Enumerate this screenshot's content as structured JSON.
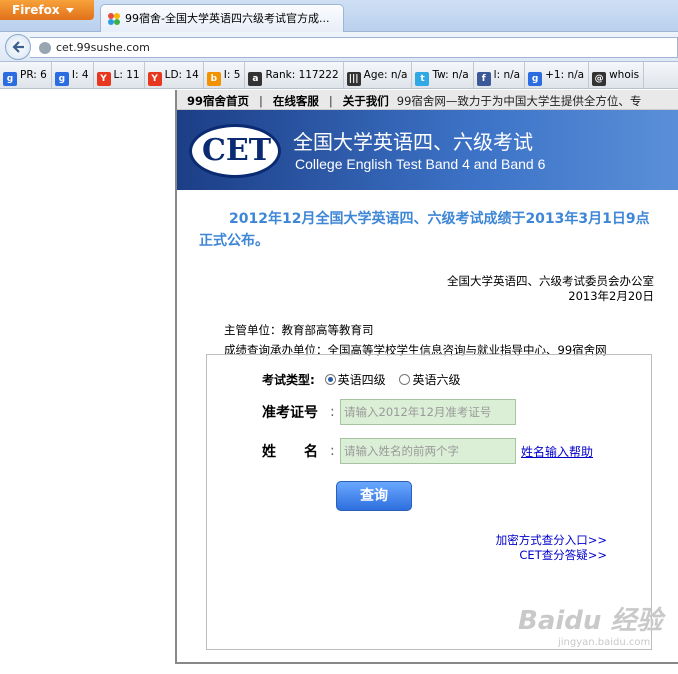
{
  "browser": {
    "app_button": "Firefox",
    "tab_title": "99宿舍-全国大学英语四六级考试官方成...",
    "url": "cet.99sushe.com"
  },
  "seo_toolbar": [
    {
      "icon": "google-icon",
      "text": "PR: 6",
      "color": "#2b6de0"
    },
    {
      "icon": "google-icon",
      "text": "I: 4",
      "color": "#2b6de0"
    },
    {
      "icon": "yahoo-icon",
      "text": "L: 11",
      "color": "#e8371f"
    },
    {
      "icon": "yahoo-icon",
      "text": "LD: 14",
      "color": "#e8371f"
    },
    {
      "icon": "bing-icon",
      "text": "I: 5",
      "color": "#f29200"
    },
    {
      "icon": "alexa-icon",
      "text": "Rank: 117222",
      "color": "#333333"
    },
    {
      "icon": "archive-icon",
      "text": "Age: n/a",
      "color": "#333333"
    },
    {
      "icon": "twitter-icon",
      "text": "Tw: n/a",
      "color": "#2fa8e6"
    },
    {
      "icon": "facebook-icon",
      "text": "l: n/a",
      "color": "#3b5998"
    },
    {
      "icon": "google-plus-icon",
      "text": "+1: n/a",
      "color": "#2b6de0"
    },
    {
      "icon": "whois-icon",
      "text": "whois",
      "color": "#333333"
    }
  ],
  "topnav": {
    "home": "99宿舍首页",
    "service": "在线客服",
    "about": "关于我们",
    "slogan": "99宿舍网—致力于为中国大学生提供全方位、专"
  },
  "banner": {
    "logo_text": "CET",
    "title": "全国大学英语四、六级考试",
    "subtitle": "College English Test Band 4 and Band 6"
  },
  "announcement": "2012年12月全国大学英语四、六级考试成绩于2013年3月1日9点正式公布。",
  "signature": {
    "office": "全国大学英语四、六级考试委员会办公室",
    "date": "2013年2月20日"
  },
  "organization": {
    "supervisor": "主管单位：教育部高等教育司",
    "operator": "成绩查询承办单位：全国高等学校学生信息咨询与就业指导中心、99宿舍网"
  },
  "form": {
    "exam_type_label": "考试类型:",
    "options": [
      "英语四级",
      "英语六级"
    ],
    "selected": "英语四级",
    "ticket_label": "准考证号",
    "ticket_placeholder": "请输入2012年12月准考证号",
    "name_label": "姓　　名",
    "name_placeholder": "请输入姓名的前两个字",
    "name_help": "姓名输入帮助",
    "submit": "查询",
    "encrypted_link": "加密方式查分入口>>",
    "faq_link": "CET查分答疑>>"
  },
  "watermark": {
    "main": "Baidu 经验",
    "sub": "jingyan.baidu.com"
  }
}
